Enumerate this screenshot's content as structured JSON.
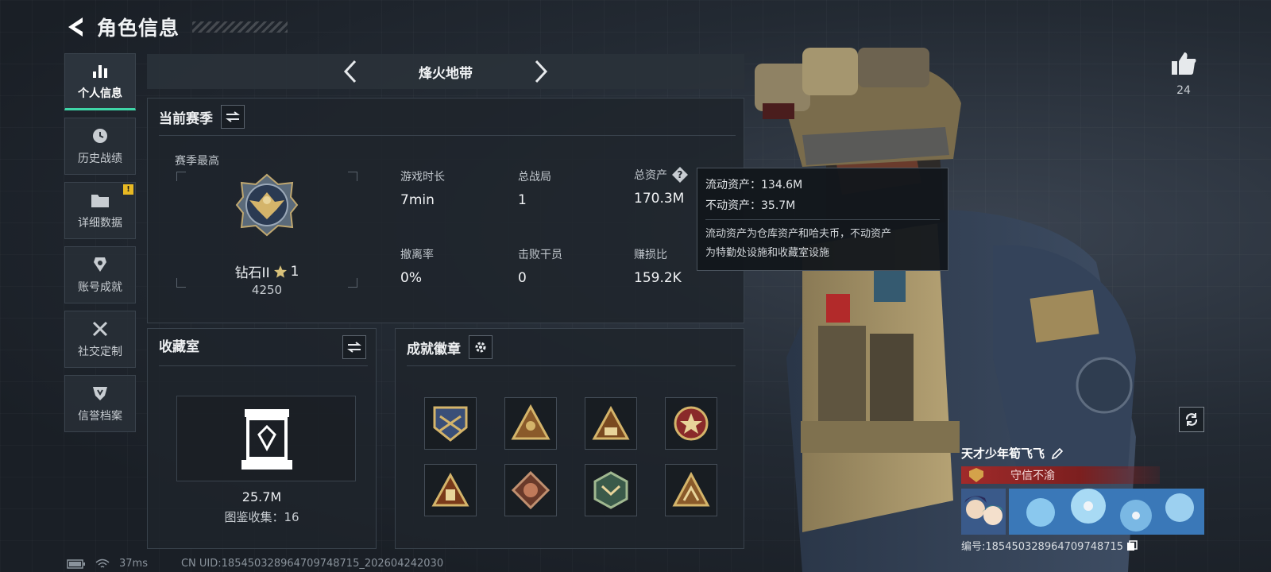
{
  "header": {
    "title": "角色信息"
  },
  "sidebar": {
    "items": [
      {
        "label": "个人信息",
        "icon": "bar-chart-icon",
        "active": true
      },
      {
        "label": "历史战绩",
        "icon": "clock-icon",
        "active": false
      },
      {
        "label": "详细数据",
        "icon": "folder-icon",
        "active": false,
        "badge": "!"
      },
      {
        "label": "账号成就",
        "icon": "trophy-icon",
        "active": false
      },
      {
        "label": "社交定制",
        "icon": "tools-icon",
        "active": false
      },
      {
        "label": "信誉档案",
        "icon": "shield-icon",
        "active": false
      }
    ]
  },
  "mode": {
    "title": "烽火地带"
  },
  "season": {
    "title": "当前赛季",
    "best_label": "赛季最高",
    "rank_name": "钻石II",
    "rank_stars": "1",
    "rank_points": "4250",
    "stats": [
      {
        "label": "游戏时长",
        "value": "7min"
      },
      {
        "label": "总战局",
        "value": "1"
      },
      {
        "label": "总资产",
        "value": "170.3M",
        "help": "?"
      },
      {
        "label": "撤离率",
        "value": "0%"
      },
      {
        "label": "击败干员",
        "value": "0"
      },
      {
        "label": "赚损比",
        "value": "159.2K"
      }
    ]
  },
  "tooltip": {
    "liquid": "流动资产：134.6M",
    "fixed": "不动资产：35.7M",
    "desc_line1": "流动资产为仓库资产和哈夫币，不动资产",
    "desc_line2": "为特勤处设施和收藏室设施"
  },
  "collection": {
    "title": "收藏室",
    "value": "25.7M",
    "count": "图鉴收集：16"
  },
  "badges": {
    "title": "成就徽章",
    "items": [
      "badge-1",
      "badge-2",
      "badge-3",
      "badge-4",
      "badge-5",
      "badge-6",
      "badge-7",
      "badge-8"
    ]
  },
  "status": {
    "ping": "37ms",
    "uid": "CN UID:1854503289647097487​15_202604242030"
  },
  "like": {
    "count": "24"
  },
  "player": {
    "name": "天才少年筍飞飞",
    "honor": "守信不渝",
    "id": "编号:185450328964709748715"
  },
  "colors": {
    "accent": "#3fd6a8",
    "background": "#1b2128",
    "honor": "#a02a2a",
    "badge_warning": "#e8b923"
  }
}
